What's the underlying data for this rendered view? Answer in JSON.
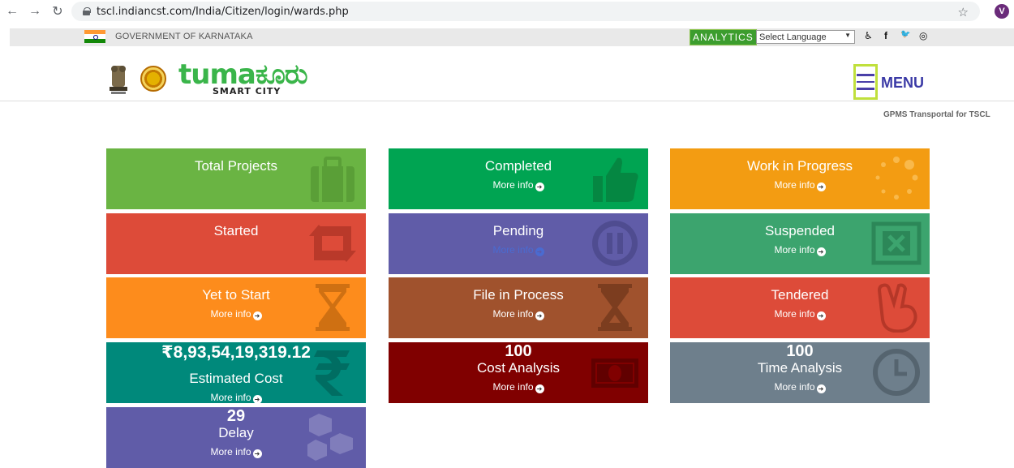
{
  "browser": {
    "url": "tscl.indiancst.com/India/Citizen/login/wards.php",
    "avatar_letter": "V"
  },
  "govbar": {
    "title": "GOVERNMENT OF KARNATAKA",
    "analytics_label": "ANALYTICS",
    "language_select": "Select Language",
    "social": [
      "♿",
      "f",
      "🐦",
      "◎"
    ]
  },
  "header": {
    "brand_name": "tumaಕೂರು",
    "brand_subtitle": "SMART CITY",
    "menu_label": "MENU",
    "portal_text": "GPMS Transportal for TSCL"
  },
  "colors": {
    "green": "#6ab443",
    "dark_green": "#00a452",
    "orange_yellow": "#f39c12",
    "red": "#dd4b39",
    "purple": "#605ca8",
    "teal_green": "#3ca46e",
    "orange": "#fd8c1c",
    "brown": "#a0522d",
    "teal": "#00897b",
    "maroon": "#800000",
    "slate": "#6e7f8c"
  },
  "tiles": {
    "total_projects": {
      "title": "Total Projects"
    },
    "completed": {
      "title": "Completed",
      "more": "More info"
    },
    "work_in_progress": {
      "title": "Work in Progress",
      "more": "More info"
    },
    "started": {
      "title": "Started"
    },
    "pending": {
      "title": "Pending",
      "more": "More info"
    },
    "suspended": {
      "title": "Suspended",
      "more": "More info"
    },
    "yet_to_start": {
      "title": "Yet to Start",
      "more": "More info"
    },
    "file_in_process": {
      "title": "File in Process",
      "more": "More info"
    },
    "tendered": {
      "title": "Tendered",
      "more": "More info"
    },
    "estimated_cost": {
      "value": "₹8,93,54,19,319.12",
      "title": "Estimated Cost",
      "more": "More info"
    },
    "cost_analysis": {
      "value": "100",
      "title": "Cost Analysis",
      "more": "More info"
    },
    "time_analysis": {
      "value": "100",
      "title": "Time Analysis",
      "more": "More info"
    },
    "delay": {
      "value": "29",
      "title": "Delay",
      "more": "More info"
    }
  }
}
